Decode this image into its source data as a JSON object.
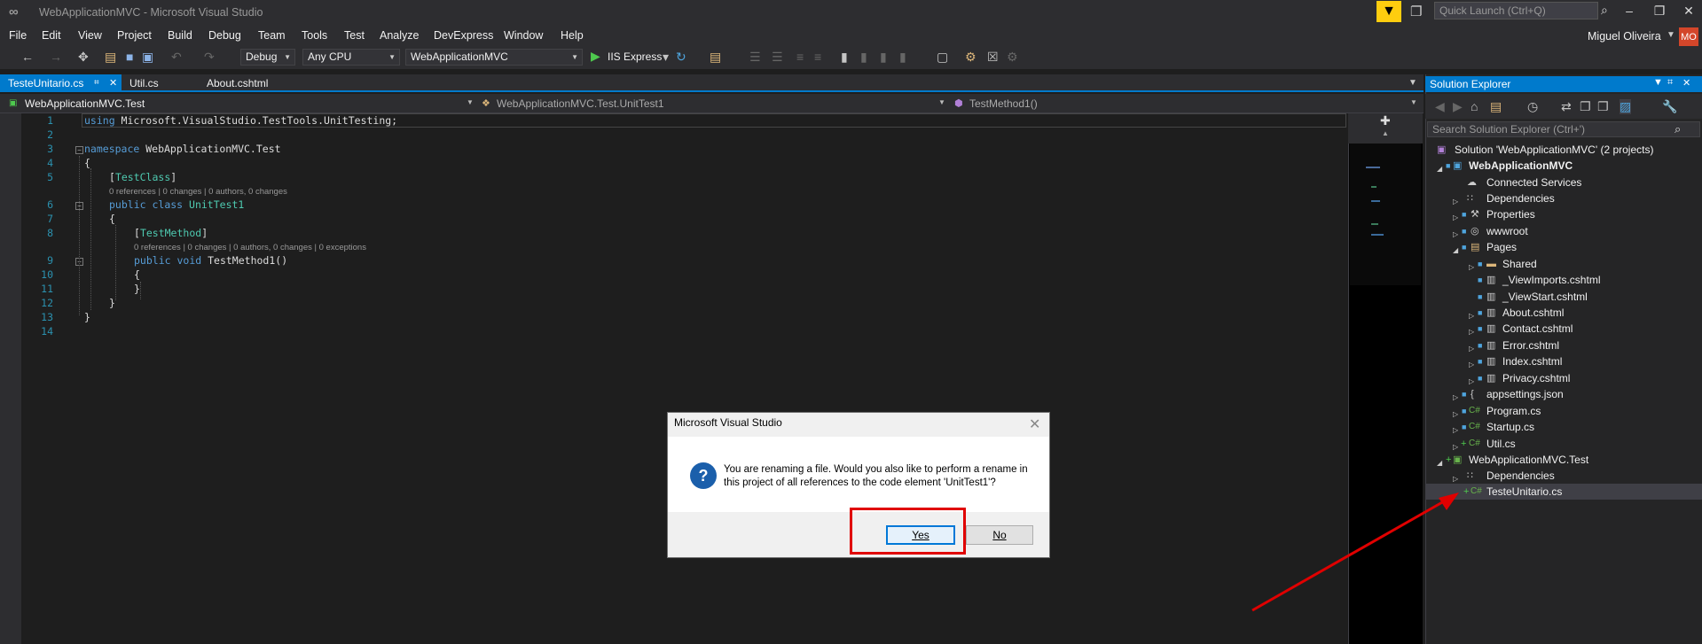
{
  "window": {
    "title": "WebApplicationMVC - Microsoft Visual Studio",
    "quick_launch_placeholder": "Quick Launch (Ctrl+Q)",
    "user_name": "Miguel Oliveira",
    "user_initials": "MO"
  },
  "menu": [
    "File",
    "Edit",
    "View",
    "Project",
    "Build",
    "Debug",
    "Team",
    "Tools",
    "Test",
    "Analyze",
    "DevExpress",
    "Window",
    "Help"
  ],
  "toolbar": {
    "configuration": "Debug",
    "platform": "Any CPU",
    "startup_project": "WebApplicationMVC",
    "run_target": "IIS Express"
  },
  "tabs": [
    {
      "label": "TesteUnitario.cs",
      "active": true
    },
    {
      "label": "Util.cs",
      "active": false
    },
    {
      "label": "About.cshtml",
      "active": false
    }
  ],
  "navbar": {
    "project": "WebApplicationMVC.Test",
    "type": "WebApplicationMVC.Test.UnitTest1",
    "member": "TestMethod1()"
  },
  "code": {
    "line_numbers": [
      "1",
      "2",
      "3",
      "4",
      "5",
      "6",
      "7",
      "8",
      "9",
      "10",
      "11",
      "12",
      "13",
      "14"
    ],
    "using_kw": "using",
    "using_ns": " Microsoft.VisualStudio.TestTools.UnitTesting;",
    "namespace_kw": "namespace",
    "namespace_name": " WebApplicationMVC.Test",
    "brace_open": "{",
    "brace_close": "}",
    "attr_open": "[",
    "attr_close": "]",
    "test_class_attr": "TestClass",
    "lens_class": "0 references | 0 changes | 0 authors, 0 changes",
    "public_kw": "public",
    "class_kw": "class",
    "class_name": " UnitTest1",
    "test_method_attr": "TestMethod",
    "lens_method": "0 references | 0 changes | 0 authors, 0 changes | 0 exceptions",
    "void_kw": "void",
    "method_sig": " TestMethod1()"
  },
  "solution_explorer": {
    "title": "Solution Explorer",
    "search_placeholder": "Search Solution Explorer (Ctrl+')",
    "items": [
      {
        "label": "Solution 'WebApplicationMVC' (2 projects)",
        "icon": "solution-icon"
      },
      {
        "label": "WebApplicationMVC",
        "icon": "web-project-icon",
        "bold": true
      },
      {
        "label": "Connected Services",
        "icon": "cloud-icon"
      },
      {
        "label": "Dependencies",
        "icon": "dependencies-icon"
      },
      {
        "label": "Properties",
        "icon": "wrench-icon"
      },
      {
        "label": "wwwroot",
        "icon": "globe-icon"
      },
      {
        "label": "Pages",
        "icon": "folder-icon"
      },
      {
        "label": "Shared",
        "icon": "folder-icon"
      },
      {
        "label": "_ViewImports.cshtml",
        "icon": "file-icon"
      },
      {
        "label": "_ViewStart.cshtml",
        "icon": "file-icon"
      },
      {
        "label": "About.cshtml",
        "icon": "file-icon"
      },
      {
        "label": "Contact.cshtml",
        "icon": "file-icon"
      },
      {
        "label": "Error.cshtml",
        "icon": "file-icon"
      },
      {
        "label": "Index.cshtml",
        "icon": "file-icon"
      },
      {
        "label": "Privacy.cshtml",
        "icon": "file-icon"
      },
      {
        "label": "appsettings.json",
        "icon": "json-icon"
      },
      {
        "label": "Program.cs",
        "icon": "csharp-icon"
      },
      {
        "label": "Startup.cs",
        "icon": "csharp-icon"
      },
      {
        "label": "Util.cs",
        "icon": "csharp-icon"
      },
      {
        "label": "WebApplicationMVC.Test",
        "icon": "test-project-icon"
      },
      {
        "label": "Dependencies",
        "icon": "dependencies-icon"
      },
      {
        "label": "TesteUnitario.cs",
        "icon": "csharp-icon",
        "selected": true
      }
    ]
  },
  "dialog": {
    "title": "Microsoft Visual Studio",
    "message": "You are renaming a file. Would you also like to perform a rename in this project of all references to the code element 'UnitTest1'?",
    "yes_label": "Yes",
    "no_label": "No"
  },
  "colors": {
    "accent": "#007acc",
    "highlight": "#e00000",
    "avatar": "#d3462a"
  }
}
